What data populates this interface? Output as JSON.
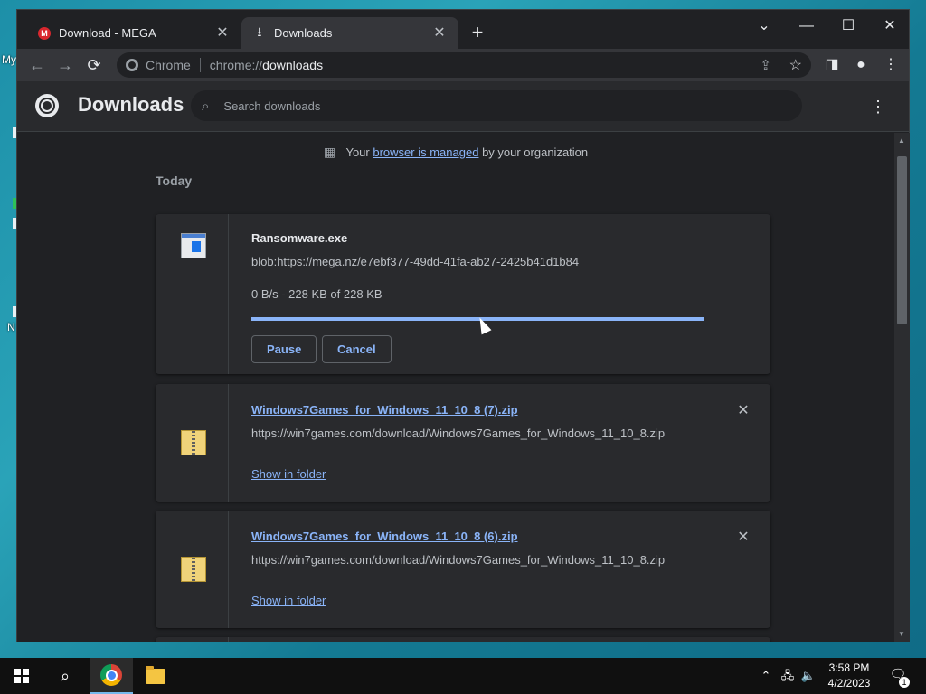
{
  "desktop": {
    "labels": [
      "My",
      "N"
    ]
  },
  "tabs": [
    {
      "title": "Download - MEGA",
      "icon": "mega-icon",
      "active": false
    },
    {
      "title": "Downloads",
      "icon": "download-icon",
      "active": true
    }
  ],
  "toolbar": {
    "omnibox_site": "Chrome",
    "omnibox_scheme": "chrome://",
    "omnibox_host": "downloads"
  },
  "downloads_header": {
    "title": "Downloads",
    "search_placeholder": "Search downloads"
  },
  "managed_notice": {
    "prefix": "Your",
    "link": "browser is managed",
    "suffix": "by your organization"
  },
  "section_label": "Today",
  "items": [
    {
      "file_name": "Ransomware.exe",
      "url": "blob:https://mega.nz/e7ebf377-49dd-41fa-ab27-2425b41d1b84",
      "status": "0 B/s - 228 KB of 228 KB",
      "progress": 1.0,
      "pause_label": "Pause",
      "cancel_label": "Cancel",
      "icon": "exe-file-icon"
    },
    {
      "file_name": "Windows7Games_for_Windows_11_10_8 (7).zip",
      "url": "https://win7games.com/download/Windows7Games_for_Windows_11_10_8.zip",
      "action_label": "Show in folder",
      "icon": "zip-file-icon"
    },
    {
      "file_name": "Windows7Games_for_Windows_11_10_8 (6).zip",
      "url": "https://win7games.com/download/Windows7Games_for_Windows_11_10_8.zip",
      "action_label": "Show in folder",
      "icon": "zip-file-icon"
    }
  ],
  "taskbar": {
    "time": "3:58 PM",
    "date": "4/2/2023",
    "notification_count": "1"
  },
  "colors": {
    "accent": "#8ab4f8",
    "background": "#202124",
    "card": "#292a2d"
  }
}
